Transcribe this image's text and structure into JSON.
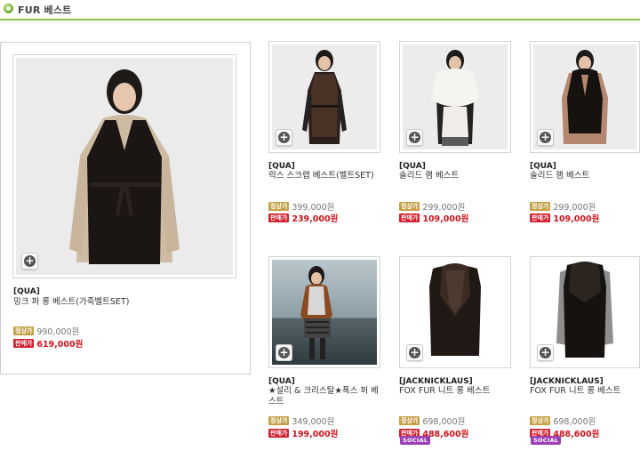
{
  "header": {
    "title": "FUR 베스트"
  },
  "labels": {
    "regular": "정상가",
    "sale": "판매가",
    "social": "SOCIAL"
  },
  "products": [
    {
      "brand": "[QUA]",
      "name": "밍크 퍼 롱 베스트(가죽벨트SET)",
      "regular_price": "990,000원",
      "sale_price": "619,000원"
    },
    {
      "brand": "[QUA]",
      "name": "럭스 스크랩 베스트(벨트SET)",
      "regular_price": "399,000원",
      "sale_price": "239,000원"
    },
    {
      "brand": "[QUA]",
      "name": "솔리드 램 베스트",
      "regular_price": "299,000원",
      "sale_price": "109,000원"
    },
    {
      "brand": "[QUA]",
      "name": "솔리드 램 베스트",
      "regular_price": "299,000원",
      "sale_price": "109,000원"
    },
    {
      "brand": "[QUA]",
      "name": "★설리 & 크리스탈★폭스 퍼 베스트",
      "regular_price": "349,000원",
      "sale_price": "199,000원"
    },
    {
      "brand": "[JACKNICKLAUS]",
      "name": "FOX FUR 니트 롱 베스트",
      "regular_price": "698,000원",
      "sale_price": "488,600원",
      "badge": "SOCIAL"
    },
    {
      "brand": "[JACKNICKLAUS]",
      "name": "FOX FUR 니트 롱 베스트",
      "regular_price": "698,000원",
      "sale_price": "488,600원",
      "badge": "SOCIAL"
    }
  ],
  "colors": {
    "accent": "#8bc34a",
    "sale": "#d4202e",
    "regular_tag": "#c4a046",
    "social": "#9b3fb5"
  },
  "icons": {
    "header_bullet": "green-circle-bullet",
    "zoom": "plus-circle-icon"
  }
}
